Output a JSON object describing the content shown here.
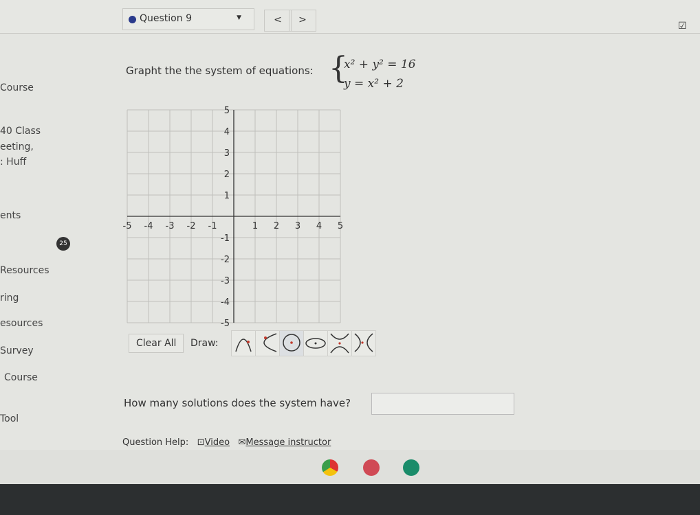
{
  "header": {
    "question_label": "Question 9",
    "prev": "<",
    "next": ">"
  },
  "sidebar": [
    "Course",
    "40 Class",
    "eeting,",
    ": Huff",
    "ents",
    "25",
    "Resources",
    "ring",
    "esources",
    "Survey",
    "Course",
    "Tool"
  ],
  "question": {
    "prompt": "Grapht the the system of equations:",
    "eq1": "x² + y² = 16",
    "eq2": "y = x² + 2"
  },
  "graph": {
    "xlim": [
      -5,
      5
    ],
    "ylim": [
      -5,
      5
    ],
    "grid": true,
    "x_ticks": [
      "-5",
      "-4",
      "-3",
      "-2",
      "-1",
      "1",
      "2",
      "3",
      "4",
      "5"
    ],
    "y_ticks": [
      "5",
      "4",
      "3",
      "2",
      "1",
      "-1",
      "-2",
      "-3",
      "-4",
      "-5"
    ]
  },
  "tools": {
    "clear_all": "Clear All",
    "draw_label": "Draw:",
    "items": [
      "parabola-vertical",
      "parabola-horizontal",
      "circle",
      "ellipse",
      "hyperbola-vertical",
      "hyperbola-horizontal"
    ],
    "selected": "circle"
  },
  "answer": {
    "question": "How many solutions does the system have?",
    "value": ""
  },
  "help": {
    "label": "Question Help:",
    "video": "Video",
    "message": "Message instructor"
  },
  "colors": {
    "accent_dot": "#2a3a8c",
    "point": "#c0392b"
  }
}
